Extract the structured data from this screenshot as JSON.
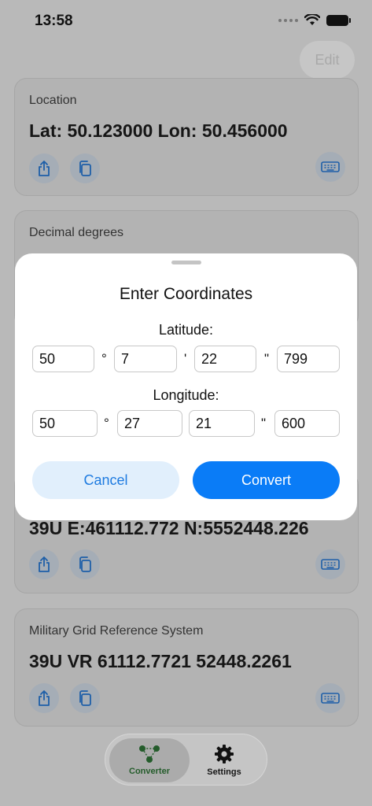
{
  "status": {
    "time": "13:58"
  },
  "nav": {
    "edit_label": "Edit"
  },
  "cards": [
    {
      "label": "Location",
      "value": "Lat: 50.123000 Lon: 50.456000"
    },
    {
      "label": "Decimal degrees",
      "value": ""
    },
    {
      "label": "",
      "value": "39U E:461112.772 N:5552448.226"
    },
    {
      "label": "Military Grid Reference System",
      "value": "39U VR 61112.7721 52448.2261"
    }
  ],
  "dialog": {
    "title": "Enter Coordinates",
    "latitude": {
      "label": "Latitude:",
      "degrees": "50",
      "minutes": "7",
      "seconds": "22",
      "fraction": "799"
    },
    "longitude": {
      "label": "Longitude:",
      "degrees": "50",
      "minutes": "27",
      "seconds": "21",
      "fraction": "600"
    },
    "separators": {
      "degree": "°",
      "minute": "'",
      "second": "\""
    },
    "cancel_label": "Cancel",
    "convert_label": "Convert"
  },
  "tabbar": {
    "tabs": [
      {
        "label": "Converter",
        "icon": "network-nodes-icon",
        "selected": true
      },
      {
        "label": "Settings",
        "icon": "gear-icon",
        "selected": false
      }
    ]
  },
  "colors": {
    "accent": "#0a7cf7",
    "cancel_bg": "#e1effc",
    "cancel_text": "#1e7be0",
    "converter_tab": "#245c2b"
  }
}
